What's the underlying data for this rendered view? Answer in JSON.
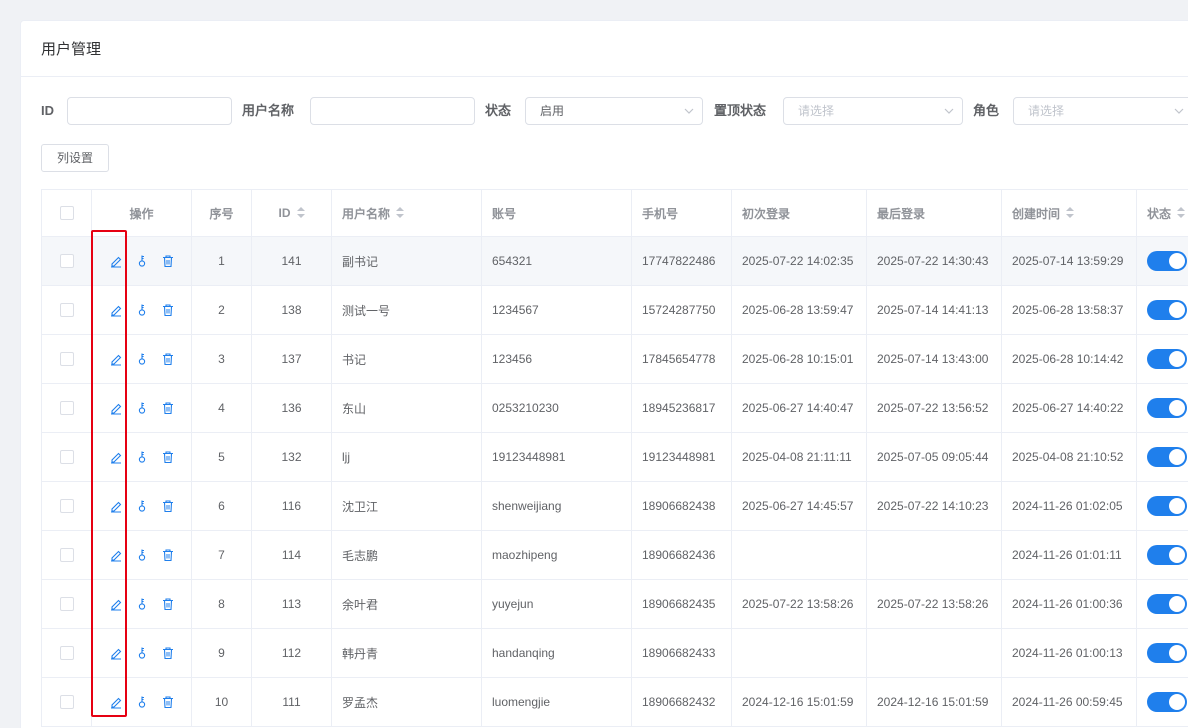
{
  "header": {
    "title": "用户管理"
  },
  "filters": {
    "id_label": "ID",
    "username_label": "用户名称",
    "status_label": "状态",
    "status_value": "启用",
    "pin_label": "置顶状态",
    "pin_placeholder": "请选择",
    "role_label": "角色",
    "role_placeholder": "请选择"
  },
  "toolbar": {
    "columns_label": "列设置"
  },
  "columns": {
    "actions": "操作",
    "index": "序号",
    "id": "ID",
    "username": "用户名称",
    "account": "账号",
    "phone": "手机号",
    "first_login": "初次登录",
    "last_login": "最后登录",
    "created": "创建时间",
    "status": "状态"
  },
  "rows": [
    {
      "index": "1",
      "id": "141",
      "username": "副书记",
      "account": "654321",
      "phone": "17747822486",
      "first_login": "2025-07-22 14:02:35",
      "last_login": "2025-07-22 14:30:43",
      "created": "2025-07-14 13:59:29",
      "enabled": true
    },
    {
      "index": "2",
      "id": "138",
      "username": "测试一号",
      "account": "1234567",
      "phone": "15724287750",
      "first_login": "2025-06-28 13:59:47",
      "last_login": "2025-07-14 14:41:13",
      "created": "2025-06-28 13:58:37",
      "enabled": true
    },
    {
      "index": "3",
      "id": "137",
      "username": "书记",
      "account": "123456",
      "phone": "17845654778",
      "first_login": "2025-06-28 10:15:01",
      "last_login": "2025-07-14 13:43:00",
      "created": "2025-06-28 10:14:42",
      "enabled": true
    },
    {
      "index": "4",
      "id": "136",
      "username": "东山",
      "account": "0253210230",
      "phone": "18945236817",
      "first_login": "2025-06-27 14:40:47",
      "last_login": "2025-07-22 13:56:52",
      "created": "2025-06-27 14:40:22",
      "enabled": true
    },
    {
      "index": "5",
      "id": "132",
      "username": "ljj",
      "account": "19123448981",
      "phone": "19123448981",
      "first_login": "2025-04-08 21:11:11",
      "last_login": "2025-07-05 09:05:44",
      "created": "2025-04-08 21:10:52",
      "enabled": true
    },
    {
      "index": "6",
      "id": "116",
      "username": "沈卫江",
      "account": "shenweijiang",
      "phone": "18906682438",
      "first_login": "2025-06-27 14:45:57",
      "last_login": "2025-07-22 14:10:23",
      "created": "2024-11-26 01:02:05",
      "enabled": true
    },
    {
      "index": "7",
      "id": "114",
      "username": "毛志鹏",
      "account": "maozhipeng",
      "phone": "18906682436",
      "first_login": "",
      "last_login": "",
      "created": "2024-11-26 01:01:11",
      "enabled": true
    },
    {
      "index": "8",
      "id": "113",
      "username": "余叶君",
      "account": "yuyejun",
      "phone": "18906682435",
      "first_login": "2025-07-22 13:58:26",
      "last_login": "2025-07-22 13:58:26",
      "created": "2024-11-26 01:00:36",
      "enabled": true
    },
    {
      "index": "9",
      "id": "112",
      "username": "韩丹青",
      "account": "handanqing",
      "phone": "18906682433",
      "first_login": "",
      "last_login": "",
      "created": "2024-11-26 01:00:13",
      "enabled": true
    },
    {
      "index": "10",
      "id": "111",
      "username": "罗孟杰",
      "account": "luomengjie",
      "phone": "18906682432",
      "first_login": "2024-12-16 15:01:59",
      "last_login": "2024-12-16 15:01:59",
      "created": "2024-11-26 00:59:45",
      "enabled": true
    }
  ],
  "colors": {
    "primary": "#1f7fec",
    "highlight_box": "#e60012",
    "border": "#ebeef5"
  }
}
